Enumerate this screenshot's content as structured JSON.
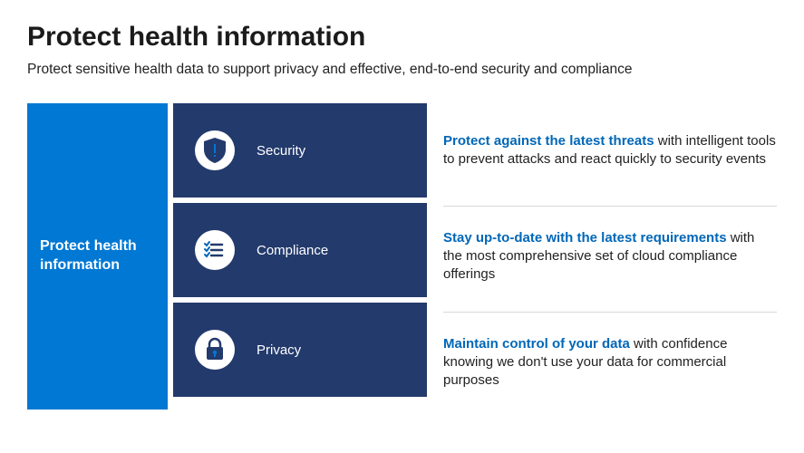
{
  "title": "Protect health information",
  "subtitle": "Protect sensitive health data to support privacy and effective, end-to-end security and compliance",
  "leftTile": {
    "label": "Protect health information"
  },
  "cards": [
    {
      "label": "Security"
    },
    {
      "label": "Compliance"
    },
    {
      "label": "Privacy"
    }
  ],
  "descriptions": [
    {
      "lead": "Protect against the latest threats",
      "rest": " with intelligent tools to prevent attacks and react quickly to security events"
    },
    {
      "lead": "Stay up-to-date with the latest requirements",
      "rest": " with the most comprehensive set of cloud compliance offerings"
    },
    {
      "lead": "Maintain control of your data",
      "rest": " with confidence knowing we don't use your data for commercial purposes"
    }
  ],
  "colors": {
    "accent": "#0078d4",
    "cardBg": "#233a6c",
    "leadText": "#0067b8"
  }
}
